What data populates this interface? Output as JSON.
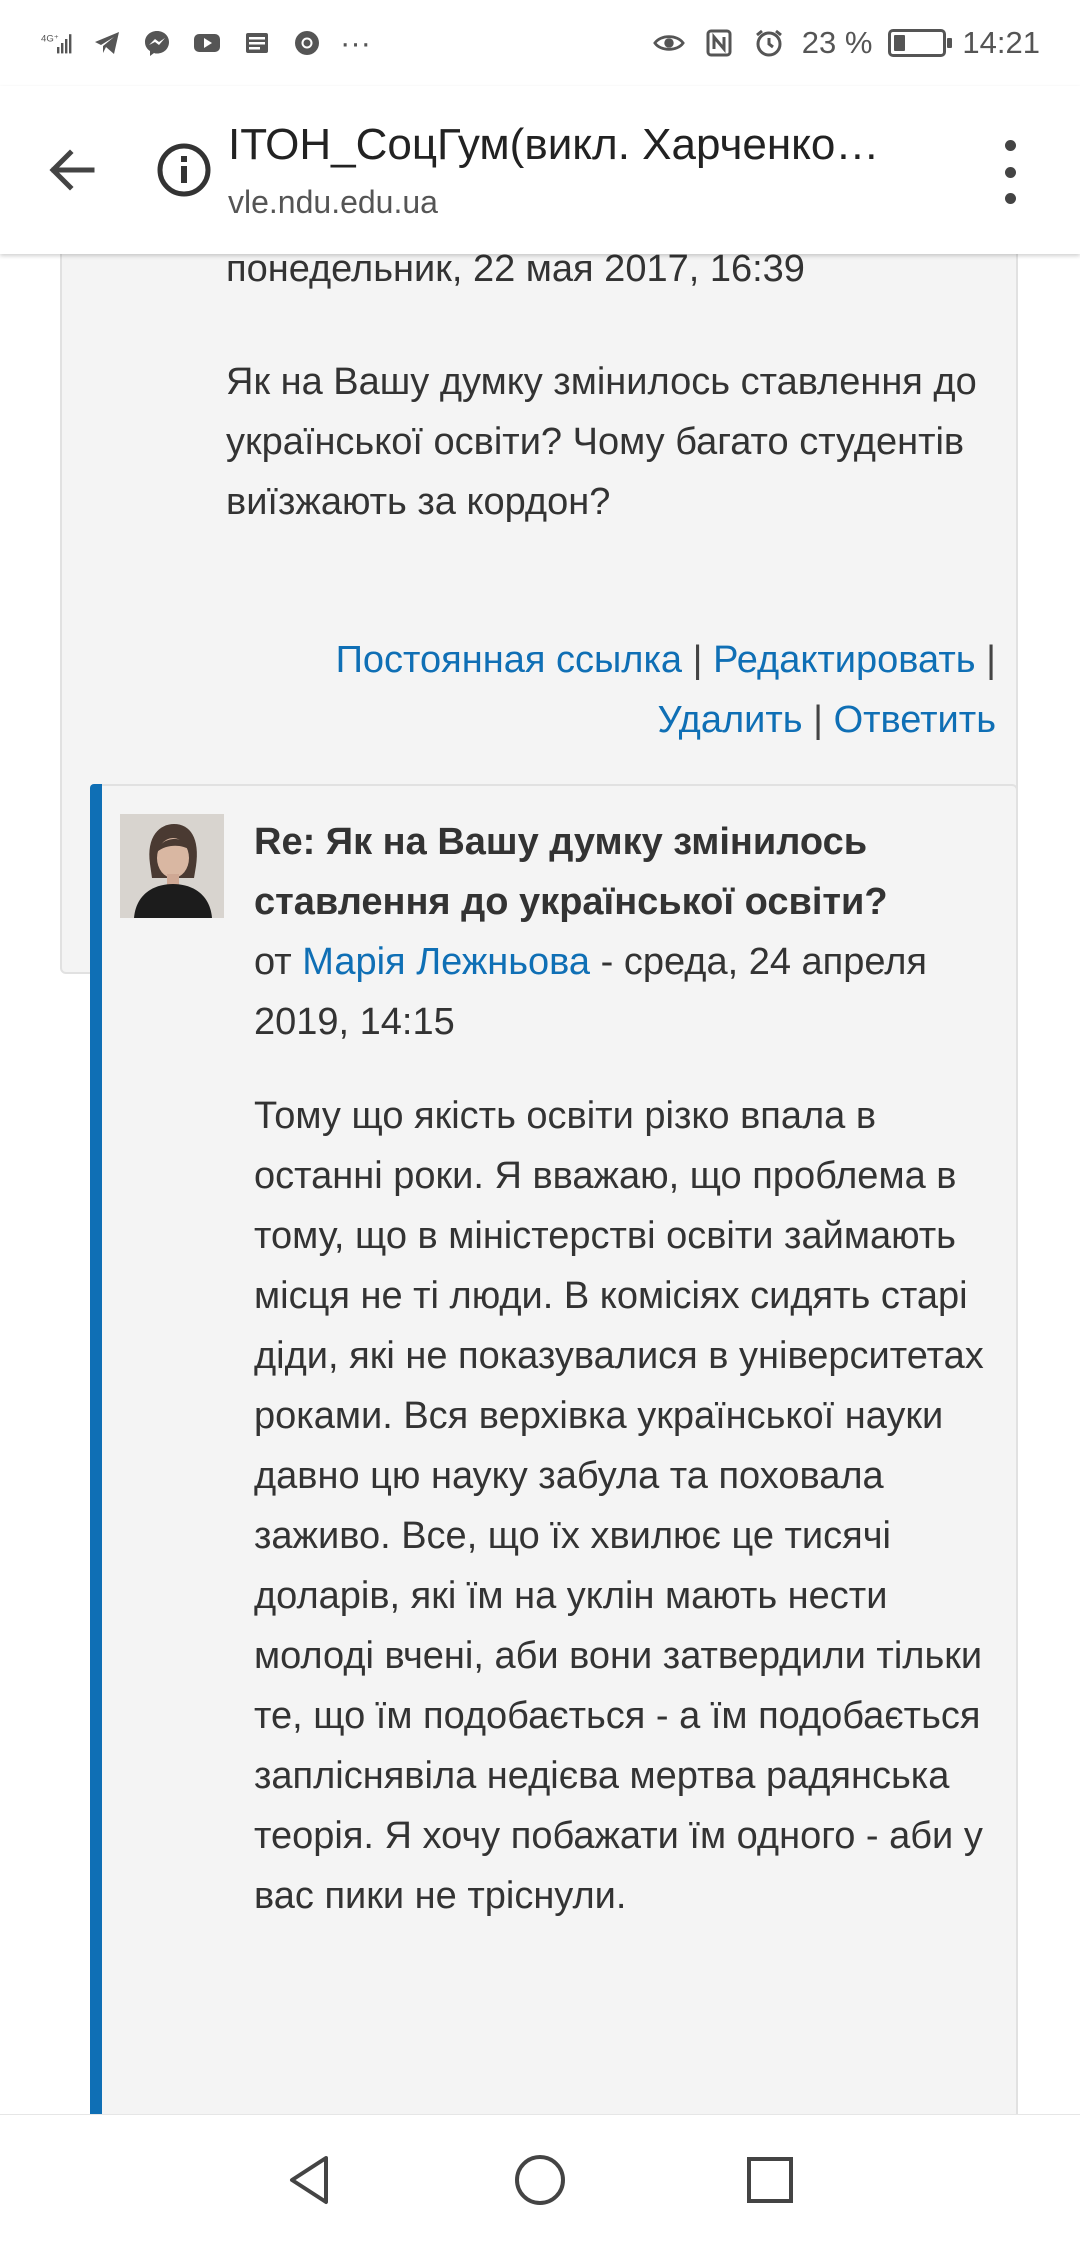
{
  "status_bar": {
    "network": "4G⁺",
    "notification_icons": [
      "telegram-icon",
      "messenger-icon",
      "youtube-icon",
      "news-icon",
      "chrome-icon"
    ],
    "more": "···",
    "battery_percent": "23 %",
    "battery_level": 0.23,
    "time": "14:21"
  },
  "browser": {
    "page_title": "ІТОН_СоцГум(викл. Харченко…",
    "url": "vle.ndu.edu.ua"
  },
  "post1": {
    "date_line": "понедельник, 22 мая 2017, 16:39",
    "body": "Як на Вашу думку змінилось ставлення до української освіти? Чому багато студентів виїзжають за кордон?",
    "actions": {
      "permalink": "Постоянная ссылка",
      "edit": "Редактировать",
      "delete": "Удалить",
      "reply": "Ответить",
      "separator": "|"
    }
  },
  "post2": {
    "subject": "Re: Як на Вашу думку змінилось ставлення до української освіти?",
    "by_prefix": "от",
    "author": "Марія Лежньова",
    "date": " - среда, 24 апреля 2019, 14:15",
    "body": "Тому що якість освіти різко впала в останні роки. Я вважаю, що проблема в тому, що в міністерстві освіти займають місця не ті люди. В комісіях сидять старі діди, які не показувалися в університетах роками. Вся верхівка української науки давно цю науку забула та поховала заживо. Все, що їх хвилює це тисячі доларів, які їм на уклін мають нести молоді вчені, аби вони затвердили тільки те, що їм подобається - а їм подобається запліснявіла недієва мертва радянська теорія. Я хочу побажати їм одного - аби у вас пики не тріснули."
  },
  "colors": {
    "link": "#0f6fb5",
    "post_background": "#f4f4f4",
    "accent_bar": "#0f6fb5"
  }
}
